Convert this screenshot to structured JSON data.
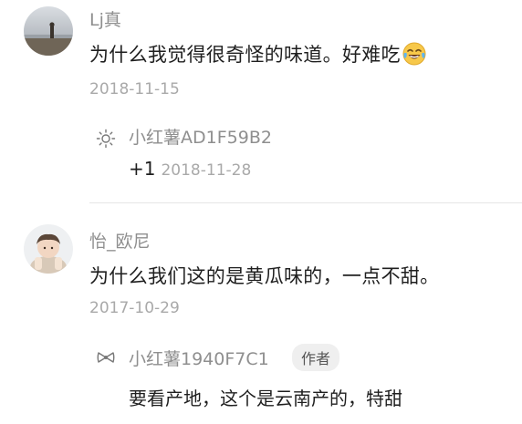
{
  "comments": [
    {
      "username": "Lj真",
      "text": "为什么我觉得很奇怪的味道。好难吃",
      "date": "2018-11-15",
      "reply": {
        "username": "小红薯AD1F59B2",
        "text": "+1",
        "date": "2018-11-28"
      }
    },
    {
      "username": "怡_欧尼",
      "text": "为什么我们这的是黄瓜味的，一点不甜。",
      "date": "2017-10-29",
      "reply": {
        "username": "小红薯1940F7C1",
        "badge": "作者",
        "text": "要看产地，这个是云南产的，特甜"
      }
    }
  ],
  "icons": {
    "laugh_emoji": "face-with-tears-of-joy-icon",
    "reply1_icon": "sun-icon",
    "reply2_icon": "bow-icon"
  },
  "colors": {
    "username": "#8f8f8f",
    "date": "#a9a9a9",
    "text": "#1f1f1f",
    "badge_bg": "#efefef"
  }
}
